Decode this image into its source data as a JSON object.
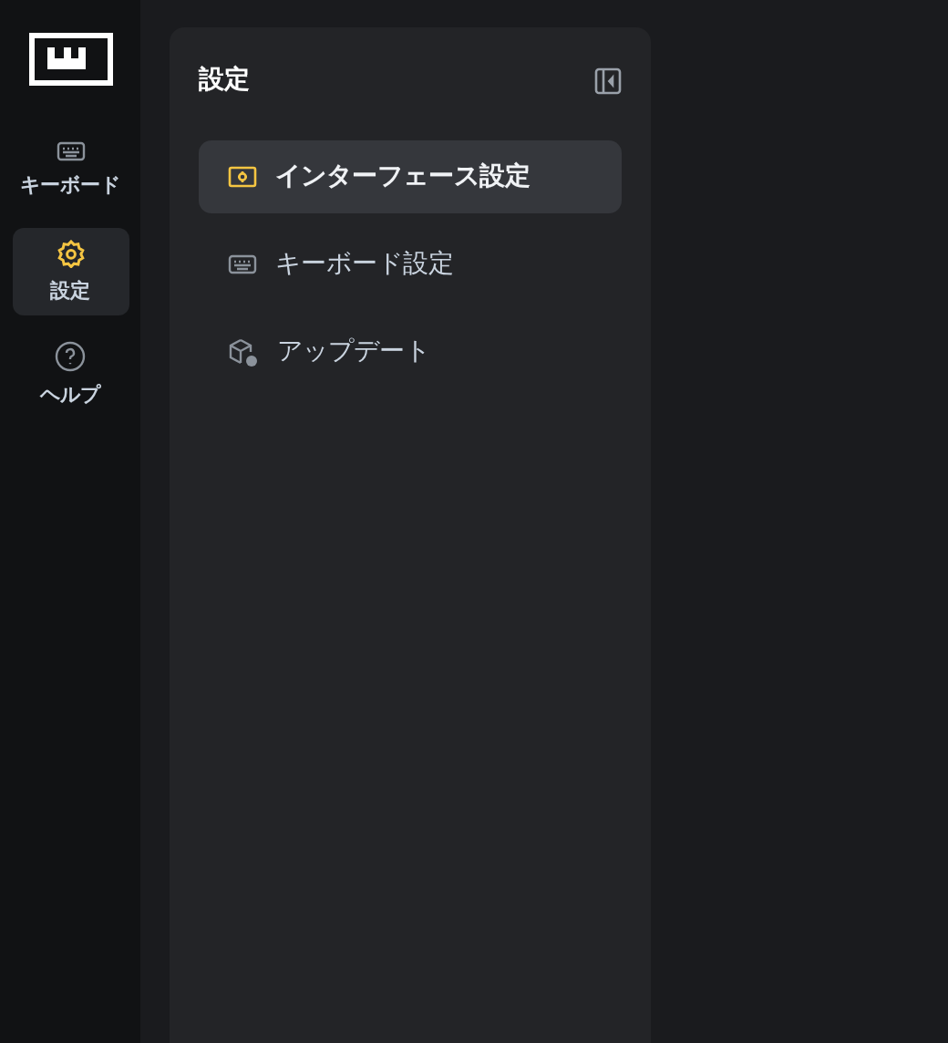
{
  "rail": {
    "items": [
      {
        "kind": "keyboard",
        "label": "キーボード",
        "selected": false
      },
      {
        "kind": "gear",
        "label": "設定",
        "selected": true
      },
      {
        "kind": "help",
        "label": "ヘルプ",
        "selected": false
      }
    ]
  },
  "panel": {
    "title": "設定",
    "items": [
      {
        "kind": "display",
        "label": "インターフェース設定",
        "selected": true
      },
      {
        "kind": "keyboard",
        "label": "キーボード設定",
        "selected": false
      },
      {
        "kind": "package",
        "label": "アップデート",
        "selected": false
      }
    ]
  }
}
